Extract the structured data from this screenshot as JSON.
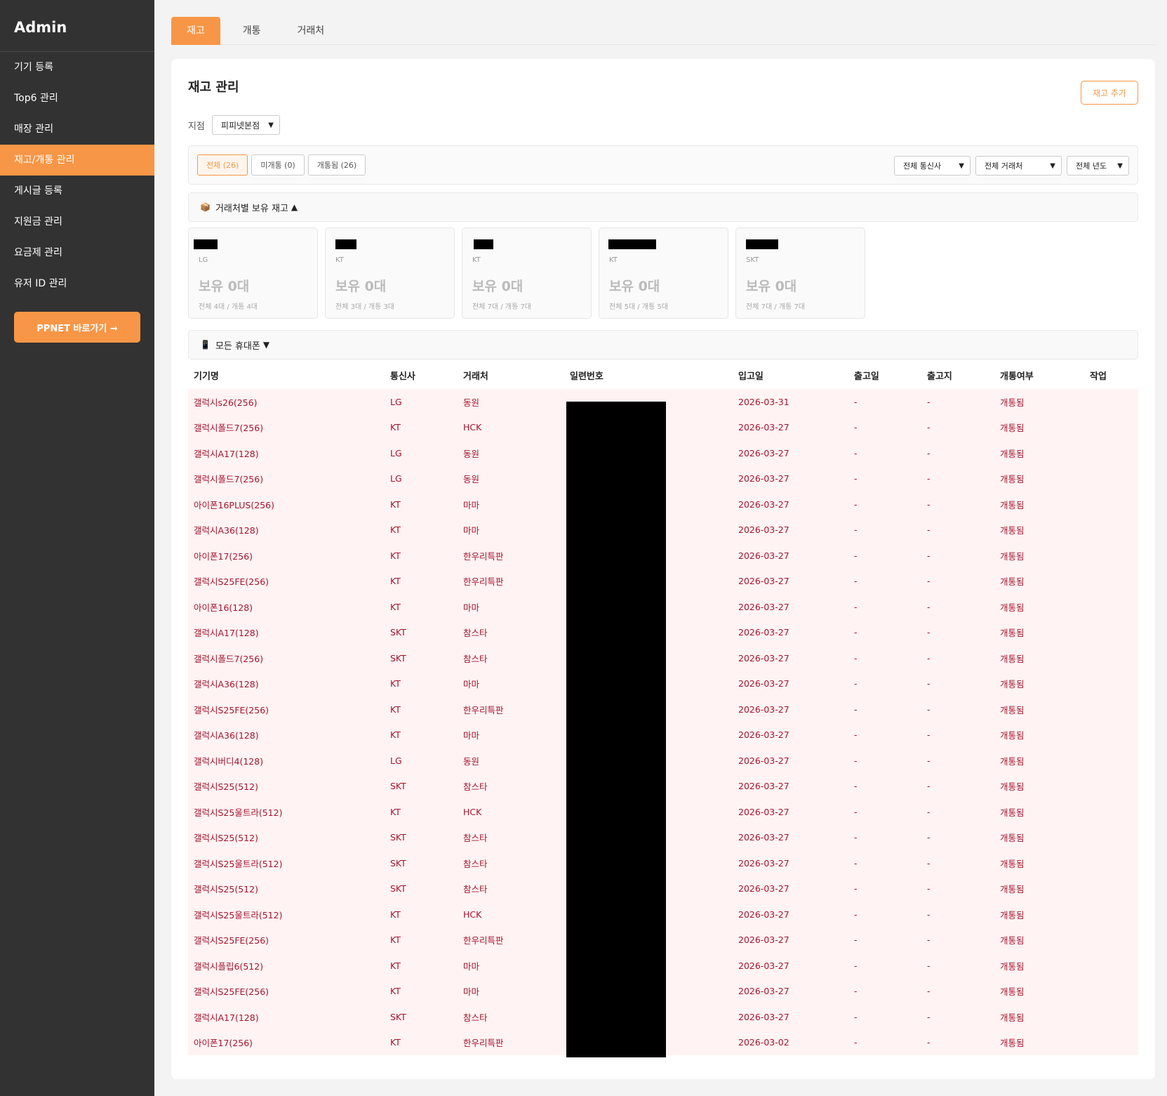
{
  "sidebar": {
    "brand": "Admin",
    "items": [
      {
        "label": "기기 등록",
        "active": false
      },
      {
        "label": "Top6 관리",
        "active": false
      },
      {
        "label": "매장 관리",
        "active": false
      },
      {
        "label": "재고/개통 관리",
        "active": true
      },
      {
        "label": "게시글 등록",
        "active": false
      },
      {
        "label": "지원금 관리",
        "active": false
      },
      {
        "label": "요금제 관리",
        "active": false
      },
      {
        "label": "유저 ID 관리",
        "active": false
      }
    ],
    "ppnet_button": "PPNET 바로가기 →"
  },
  "tabs": [
    {
      "label": "재고",
      "active": true
    },
    {
      "label": "개통",
      "active": false
    },
    {
      "label": "거래처",
      "active": false
    }
  ],
  "page": {
    "title": "재고 관리",
    "add_button": "재고 추가",
    "branch_label": "지점",
    "branch_value": "피피넷본점"
  },
  "filters": {
    "chips": [
      {
        "label": "전체 (26)",
        "active": true
      },
      {
        "label": "미개통 (0)",
        "active": false
      },
      {
        "label": "개통됨 (26)",
        "active": false
      }
    ],
    "carrier_select": "전체 통신사",
    "vendor_select": "전체 거래처",
    "year_select": "전체 년도"
  },
  "vendor_section": {
    "title": "거래처별 보유 재고",
    "icon": "package-icon",
    "toggle": "▲",
    "cards": [
      {
        "carrier": "LG",
        "holding": "보유 0대",
        "summary": "전체 4대 / 개통 4대"
      },
      {
        "carrier": "KT",
        "holding": "보유 0대",
        "summary": "전체 3대 / 개통 3대"
      },
      {
        "carrier": "KT",
        "holding": "보유 0대",
        "summary": "전체 7대 / 개통 7대"
      },
      {
        "carrier": "KT",
        "holding": "보유 0대",
        "summary": "전체 5대 / 개통 5대"
      },
      {
        "carrier": "SKT",
        "holding": "보유 0대",
        "summary": "전체 7대 / 개통 7대"
      }
    ]
  },
  "phones_section": {
    "title": "모든 휴대폰",
    "icon": "phone-icon",
    "toggle": "▼"
  },
  "table": {
    "headers": [
      "기기명",
      "통신사",
      "거래처",
      "일련번호",
      "입고일",
      "출고일",
      "출고지",
      "개통여부",
      "작업"
    ],
    "rows": [
      [
        "갤럭시s26(256)",
        "LG",
        "동원",
        "",
        "2026-03-31",
        "-",
        "-",
        "개통됨",
        ""
      ],
      [
        "갤럭시폴드7(256)",
        "KT",
        "HCK",
        "",
        "2026-03-27",
        "-",
        "-",
        "개통됨",
        ""
      ],
      [
        "갤럭시A17(128)",
        "LG",
        "동원",
        "",
        "2026-03-27",
        "-",
        "-",
        "개통됨",
        ""
      ],
      [
        "갤럭시폴드7(256)",
        "LG",
        "동원",
        "",
        "2026-03-27",
        "-",
        "-",
        "개통됨",
        ""
      ],
      [
        "아이폰16PLUS(256)",
        "KT",
        "마마",
        "",
        "2026-03-27",
        "-",
        "-",
        "개통됨",
        ""
      ],
      [
        "갤럭시A36(128)",
        "KT",
        "마마",
        "",
        "2026-03-27",
        "-",
        "-",
        "개통됨",
        ""
      ],
      [
        "아이폰17(256)",
        "KT",
        "한우리특판",
        "",
        "2026-03-27",
        "-",
        "-",
        "개통됨",
        ""
      ],
      [
        "갤럭시S25FE(256)",
        "KT",
        "한우리특판",
        "",
        "2026-03-27",
        "-",
        "-",
        "개통됨",
        ""
      ],
      [
        "아이폰16(128)",
        "KT",
        "마마",
        "",
        "2026-03-27",
        "-",
        "-",
        "개통됨",
        ""
      ],
      [
        "갤럭시A17(128)",
        "SKT",
        "참스타",
        "",
        "2026-03-27",
        "-",
        "-",
        "개통됨",
        ""
      ],
      [
        "갤럭시폴드7(256)",
        "SKT",
        "참스타",
        "",
        "2026-03-27",
        "-",
        "-",
        "개통됨",
        ""
      ],
      [
        "갤럭시A36(128)",
        "KT",
        "마마",
        "",
        "2026-03-27",
        "-",
        "-",
        "개통됨",
        ""
      ],
      [
        "갤럭시S25FE(256)",
        "KT",
        "한우리특판",
        "",
        "2026-03-27",
        "-",
        "-",
        "개통됨",
        ""
      ],
      [
        "갤럭시A36(128)",
        "KT",
        "마마",
        "",
        "2026-03-27",
        "-",
        "-",
        "개통됨",
        ""
      ],
      [
        "갤럭시버디4(128)",
        "LG",
        "동원",
        "",
        "2026-03-27",
        "-",
        "-",
        "개통됨",
        ""
      ],
      [
        "갤럭시S25(512)",
        "SKT",
        "참스타",
        "",
        "2026-03-27",
        "-",
        "-",
        "개통됨",
        ""
      ],
      [
        "갤럭시S25울트라(512)",
        "KT",
        "HCK",
        "",
        "2026-03-27",
        "-",
        "-",
        "개통됨",
        ""
      ],
      [
        "갤럭시S25(512)",
        "SKT",
        "참스타",
        "",
        "2026-03-27",
        "-",
        "-",
        "개통됨",
        ""
      ],
      [
        "갤럭시S25울트라(512)",
        "SKT",
        "참스타",
        "",
        "2026-03-27",
        "-",
        "-",
        "개통됨",
        ""
      ],
      [
        "갤럭시S25(512)",
        "SKT",
        "참스타",
        "",
        "2026-03-27",
        "-",
        "-",
        "개통됨",
        ""
      ],
      [
        "갤럭시S25울트라(512)",
        "KT",
        "HCK",
        "",
        "2026-03-27",
        "-",
        "-",
        "개통됨",
        ""
      ],
      [
        "갤럭시S25FE(256)",
        "KT",
        "한우리특판",
        "",
        "2026-03-27",
        "-",
        "-",
        "개통됨",
        ""
      ],
      [
        "갤럭시플립6(512)",
        "KT",
        "마마",
        "",
        "2026-03-27",
        "-",
        "-",
        "개통됨",
        ""
      ],
      [
        "갤럭시S25FE(256)",
        "KT",
        "마마",
        "",
        "2026-03-27",
        "-",
        "-",
        "개통됨",
        ""
      ],
      [
        "갤럭시A17(128)",
        "SKT",
        "참스타",
        "",
        "2026-03-27",
        "-",
        "-",
        "개통됨",
        ""
      ],
      [
        "아이폰17(256)",
        "KT",
        "한우리특판",
        "",
        "2026-03-02",
        "-",
        "-",
        "개통됨",
        ""
      ]
    ]
  },
  "colors": {
    "accent": "#f79646",
    "sidebar_bg": "#323232",
    "row_bg": "#fff3f3",
    "row_text": "#a4142d"
  }
}
